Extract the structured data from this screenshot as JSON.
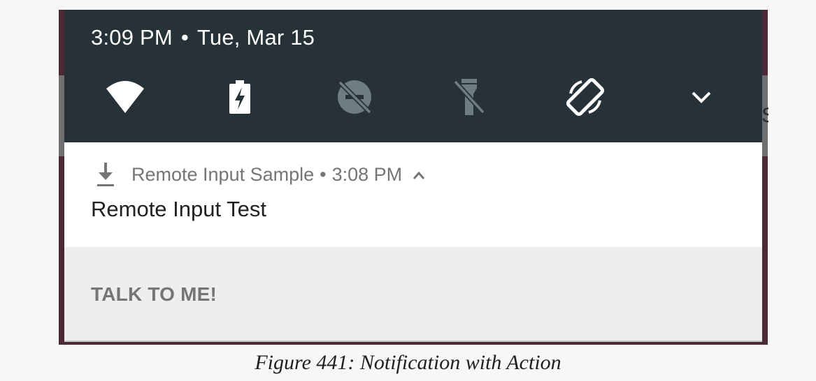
{
  "status_bar": {
    "time": "3:09 PM",
    "separator": "•",
    "date": "Tue, Mar 15"
  },
  "quick_settings": [
    {
      "icon": "wifi-icon",
      "state": "on"
    },
    {
      "icon": "battery-charging-icon",
      "state": "on"
    },
    {
      "icon": "do-not-disturb-off-icon",
      "state": "off"
    },
    {
      "icon": "flashlight-off-icon",
      "state": "off"
    },
    {
      "icon": "auto-rotate-icon",
      "state": "on"
    },
    {
      "icon": "chevron-down-icon",
      "state": "expand"
    }
  ],
  "notification": {
    "app_icon": "download-icon",
    "app_name": "Remote Input Sample",
    "separator": "•",
    "time": "3:08 PM",
    "expand_icon": "chevron-up-icon",
    "title": "Remote Input Test"
  },
  "actions": {
    "primary_label": "TALK TO ME!"
  },
  "caption": "Figure 441: Notification with Action",
  "colors": {
    "shade_background": "#263238",
    "frame_background": "#4a2a35",
    "notification_background": "#ffffff",
    "actions_background": "#eeeeee",
    "active_icon": "#ffffff",
    "inactive_icon": "#6f7c81"
  }
}
